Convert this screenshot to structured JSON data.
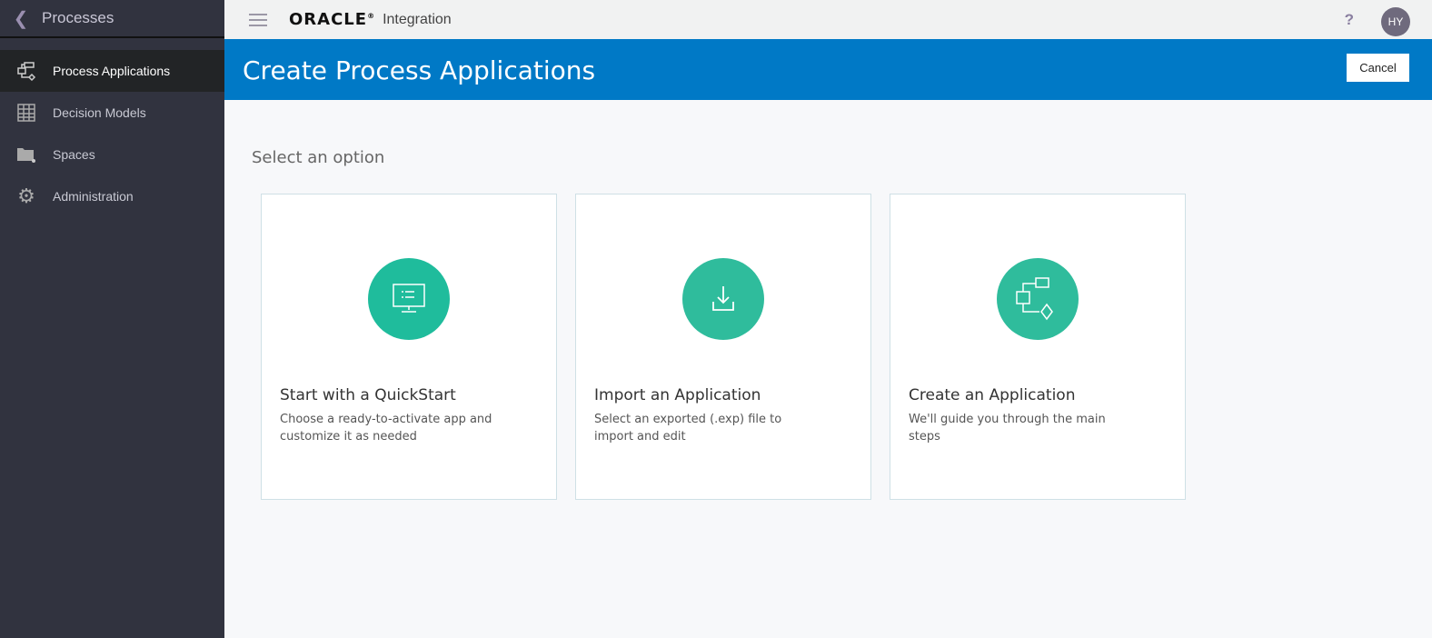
{
  "sidebar": {
    "title": "Processes",
    "items": [
      {
        "label": "Process Applications",
        "icon": "process-flow-icon",
        "active": true
      },
      {
        "label": "Decision Models",
        "icon": "table-grid-icon"
      },
      {
        "label": "Spaces",
        "icon": "folder-share-icon"
      },
      {
        "label": "Administration",
        "icon": "gear-icon"
      }
    ]
  },
  "header": {
    "brand": "ORACLE",
    "brand_mark": "®",
    "product": "Integration",
    "help": "?",
    "avatar": "HY"
  },
  "banner": {
    "title": "Create Process Applications",
    "cancel": "Cancel"
  },
  "main": {
    "heading": "Select an option",
    "cards": [
      {
        "title": "Start with a QuickStart",
        "desc": "Choose a ready-to-activate app and customize it as needed",
        "icon": "monitor-icon"
      },
      {
        "title": "Import an Application",
        "desc": "Select an exported (.exp) file to import and edit",
        "icon": "download-icon"
      },
      {
        "title": "Create an Application",
        "desc": "We'll guide you through the main steps",
        "icon": "process-flow-icon"
      }
    ]
  },
  "colors": {
    "accent": "#0079c6",
    "sidebar": "#31333f",
    "tile": "#2fbc9c"
  }
}
